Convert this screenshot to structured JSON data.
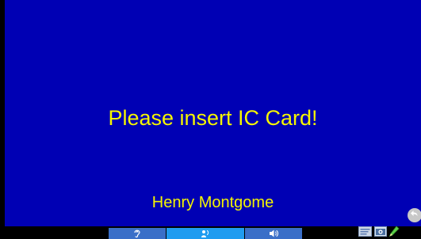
{
  "screen": {
    "message": "Please insert IC Card!",
    "user_name": "Henry Montgome"
  },
  "toolbar": {
    "buttons": [
      {
        "name": "listen",
        "icon": "ear-icon"
      },
      {
        "name": "talk",
        "icon": "talk-icon"
      },
      {
        "name": "volume",
        "icon": "speaker-icon"
      }
    ],
    "tools": [
      {
        "name": "message",
        "icon": "message-icon"
      },
      {
        "name": "camera",
        "icon": "camera-icon"
      },
      {
        "name": "edit",
        "icon": "pencil-icon"
      }
    ],
    "back_icon": "back-arrow-icon"
  },
  "colors": {
    "panel": "#0000b4",
    "text": "#f5f500",
    "button": "#3a6fc8",
    "button_active": "#1f9cf0",
    "background": "#000000"
  }
}
